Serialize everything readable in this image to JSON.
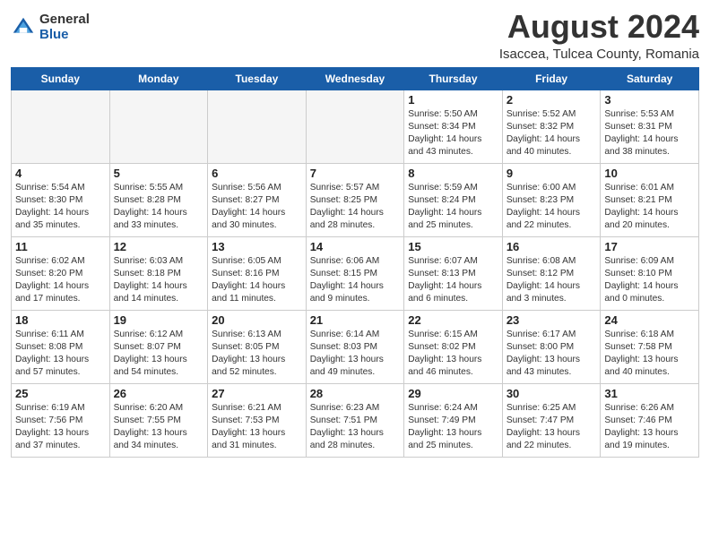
{
  "header": {
    "logo_general": "General",
    "logo_blue": "Blue",
    "month_year": "August 2024",
    "location": "Isaccea, Tulcea County, Romania"
  },
  "days_of_week": [
    "Sunday",
    "Monday",
    "Tuesday",
    "Wednesday",
    "Thursday",
    "Friday",
    "Saturday"
  ],
  "weeks": [
    [
      {
        "day": "",
        "info": ""
      },
      {
        "day": "",
        "info": ""
      },
      {
        "day": "",
        "info": ""
      },
      {
        "day": "",
        "info": ""
      },
      {
        "day": "1",
        "info": "Sunrise: 5:50 AM\nSunset: 8:34 PM\nDaylight: 14 hours\nand 43 minutes."
      },
      {
        "day": "2",
        "info": "Sunrise: 5:52 AM\nSunset: 8:32 PM\nDaylight: 14 hours\nand 40 minutes."
      },
      {
        "day": "3",
        "info": "Sunrise: 5:53 AM\nSunset: 8:31 PM\nDaylight: 14 hours\nand 38 minutes."
      }
    ],
    [
      {
        "day": "4",
        "info": "Sunrise: 5:54 AM\nSunset: 8:30 PM\nDaylight: 14 hours\nand 35 minutes."
      },
      {
        "day": "5",
        "info": "Sunrise: 5:55 AM\nSunset: 8:28 PM\nDaylight: 14 hours\nand 33 minutes."
      },
      {
        "day": "6",
        "info": "Sunrise: 5:56 AM\nSunset: 8:27 PM\nDaylight: 14 hours\nand 30 minutes."
      },
      {
        "day": "7",
        "info": "Sunrise: 5:57 AM\nSunset: 8:25 PM\nDaylight: 14 hours\nand 28 minutes."
      },
      {
        "day": "8",
        "info": "Sunrise: 5:59 AM\nSunset: 8:24 PM\nDaylight: 14 hours\nand 25 minutes."
      },
      {
        "day": "9",
        "info": "Sunrise: 6:00 AM\nSunset: 8:23 PM\nDaylight: 14 hours\nand 22 minutes."
      },
      {
        "day": "10",
        "info": "Sunrise: 6:01 AM\nSunset: 8:21 PM\nDaylight: 14 hours\nand 20 minutes."
      }
    ],
    [
      {
        "day": "11",
        "info": "Sunrise: 6:02 AM\nSunset: 8:20 PM\nDaylight: 14 hours\nand 17 minutes."
      },
      {
        "day": "12",
        "info": "Sunrise: 6:03 AM\nSunset: 8:18 PM\nDaylight: 14 hours\nand 14 minutes."
      },
      {
        "day": "13",
        "info": "Sunrise: 6:05 AM\nSunset: 8:16 PM\nDaylight: 14 hours\nand 11 minutes."
      },
      {
        "day": "14",
        "info": "Sunrise: 6:06 AM\nSunset: 8:15 PM\nDaylight: 14 hours\nand 9 minutes."
      },
      {
        "day": "15",
        "info": "Sunrise: 6:07 AM\nSunset: 8:13 PM\nDaylight: 14 hours\nand 6 minutes."
      },
      {
        "day": "16",
        "info": "Sunrise: 6:08 AM\nSunset: 8:12 PM\nDaylight: 14 hours\nand 3 minutes."
      },
      {
        "day": "17",
        "info": "Sunrise: 6:09 AM\nSunset: 8:10 PM\nDaylight: 14 hours\nand 0 minutes."
      }
    ],
    [
      {
        "day": "18",
        "info": "Sunrise: 6:11 AM\nSunset: 8:08 PM\nDaylight: 13 hours\nand 57 minutes."
      },
      {
        "day": "19",
        "info": "Sunrise: 6:12 AM\nSunset: 8:07 PM\nDaylight: 13 hours\nand 54 minutes."
      },
      {
        "day": "20",
        "info": "Sunrise: 6:13 AM\nSunset: 8:05 PM\nDaylight: 13 hours\nand 52 minutes."
      },
      {
        "day": "21",
        "info": "Sunrise: 6:14 AM\nSunset: 8:03 PM\nDaylight: 13 hours\nand 49 minutes."
      },
      {
        "day": "22",
        "info": "Sunrise: 6:15 AM\nSunset: 8:02 PM\nDaylight: 13 hours\nand 46 minutes."
      },
      {
        "day": "23",
        "info": "Sunrise: 6:17 AM\nSunset: 8:00 PM\nDaylight: 13 hours\nand 43 minutes."
      },
      {
        "day": "24",
        "info": "Sunrise: 6:18 AM\nSunset: 7:58 PM\nDaylight: 13 hours\nand 40 minutes."
      }
    ],
    [
      {
        "day": "25",
        "info": "Sunrise: 6:19 AM\nSunset: 7:56 PM\nDaylight: 13 hours\nand 37 minutes."
      },
      {
        "day": "26",
        "info": "Sunrise: 6:20 AM\nSunset: 7:55 PM\nDaylight: 13 hours\nand 34 minutes."
      },
      {
        "day": "27",
        "info": "Sunrise: 6:21 AM\nSunset: 7:53 PM\nDaylight: 13 hours\nand 31 minutes."
      },
      {
        "day": "28",
        "info": "Sunrise: 6:23 AM\nSunset: 7:51 PM\nDaylight: 13 hours\nand 28 minutes."
      },
      {
        "day": "29",
        "info": "Sunrise: 6:24 AM\nSunset: 7:49 PM\nDaylight: 13 hours\nand 25 minutes."
      },
      {
        "day": "30",
        "info": "Sunrise: 6:25 AM\nSunset: 7:47 PM\nDaylight: 13 hours\nand 22 minutes."
      },
      {
        "day": "31",
        "info": "Sunrise: 6:26 AM\nSunset: 7:46 PM\nDaylight: 13 hours\nand 19 minutes."
      }
    ]
  ]
}
